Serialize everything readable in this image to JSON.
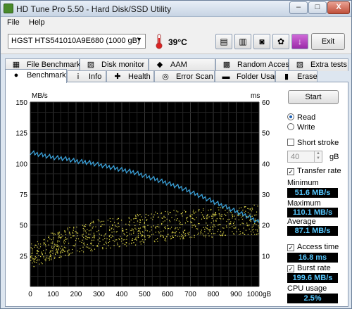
{
  "window": {
    "title": "HD Tune Pro 5.50 - Hard Disk/SSD Utility",
    "min_label": "–",
    "max_label": "□",
    "close_label": "X"
  },
  "menu": {
    "items": [
      "File",
      "Help"
    ]
  },
  "toolbar": {
    "drive": "HGST HTS541010A9E680 (1000 gB)",
    "temperature": "39°C",
    "buttons": [
      {
        "name": "copy-info-icon",
        "glyph": "▤"
      },
      {
        "name": "copy-text-icon",
        "glyph": "▥"
      },
      {
        "name": "screenshot-icon",
        "glyph": "◙"
      },
      {
        "name": "options-icon",
        "glyph": "✿"
      },
      {
        "name": "save-icon",
        "glyph": "↓"
      }
    ],
    "exit_label": "Exit"
  },
  "tabs": {
    "row1": [
      {
        "label": "File Benchmark",
        "icon": "file-benchmark-icon",
        "glyph": "▦"
      },
      {
        "label": "Disk monitor",
        "icon": "disk-monitor-icon",
        "glyph": "▨"
      },
      {
        "label": "AAM",
        "icon": "aam-icon",
        "glyph": "◆"
      },
      {
        "label": "Random Access",
        "icon": "random-access-icon",
        "glyph": "▩"
      },
      {
        "label": "Extra tests",
        "icon": "extra-tests-icon",
        "glyph": "▧"
      }
    ],
    "row2": [
      {
        "label": "Benchmark",
        "icon": "benchmark-icon",
        "glyph": "●",
        "active": true
      },
      {
        "label": "Info",
        "icon": "info-icon",
        "glyph": "i"
      },
      {
        "label": "Health",
        "icon": "health-icon",
        "glyph": "✚"
      },
      {
        "label": "Error Scan",
        "icon": "error-scan-icon",
        "glyph": "◎"
      },
      {
        "label": "Folder Usage",
        "icon": "folder-usage-icon",
        "glyph": "▬"
      },
      {
        "label": "Erase",
        "icon": "erase-icon",
        "glyph": "▮"
      }
    ]
  },
  "benchmark": {
    "start_label": "Start",
    "read_label": "Read",
    "write_label": "Write",
    "read_selected": true,
    "short_stroke_label": "Short stroke",
    "short_stroke_checked": false,
    "short_stroke_value": "40",
    "short_stroke_unit": "gB",
    "transfer_rate_label": "Transfer rate",
    "transfer_rate_checked": true,
    "minimum_label": "Minimum",
    "minimum_value": "51.6 MB/s",
    "maximum_label": "Maximum",
    "maximum_value": "110.1 MB/s",
    "average_label": "Average",
    "average_value": "87.1 MB/s",
    "access_time_label": "Access time",
    "access_time_checked": true,
    "access_time_value": "16.8 ms",
    "burst_rate_label": "Burst rate",
    "burst_rate_checked": true,
    "burst_rate_value": "199.6 MB/s",
    "cpu_usage_label": "CPU usage",
    "cpu_usage_value": "2.5%"
  },
  "chart_data": {
    "type": "line",
    "ylabel_left": "MB/s",
    "ylabel_right": "ms",
    "x_ticks": [
      "0",
      "100",
      "200",
      "300",
      "400",
      "500",
      "600",
      "700",
      "800",
      "900",
      "1000gB"
    ],
    "y_left_ticks": [
      "150",
      "125",
      "100",
      "75",
      "50",
      "25"
    ],
    "y_right_ticks": [
      "60",
      "50",
      "40",
      "30",
      "20",
      "10"
    ],
    "xlim": [
      0,
      1000
    ],
    "ylim_left": [
      0,
      150
    ],
    "ylim_right": [
      0,
      60
    ],
    "grid": true,
    "transfer_rate": {
      "name": "Transfer rate",
      "color": "#3aa0d8",
      "x": [
        0,
        50,
        100,
        150,
        200,
        250,
        300,
        350,
        400,
        450,
        500,
        550,
        600,
        650,
        700,
        750,
        800,
        850,
        900,
        950,
        1000
      ],
      "y": [
        109,
        107,
        105,
        104,
        102,
        101,
        99,
        97,
        95,
        93,
        90,
        87,
        84,
        81,
        77,
        73,
        69,
        65,
        61,
        57,
        52
      ]
    },
    "access_time": {
      "name": "Access time",
      "color": "#e8e04a",
      "x_range": [
        0,
        1000
      ],
      "ms_low": [
        6,
        9,
        11,
        12,
        13,
        14,
        15,
        16,
        16,
        17,
        17
      ],
      "ms_high": [
        14,
        18,
        20,
        22,
        23,
        24,
        25,
        25,
        26,
        26,
        27
      ]
    }
  }
}
